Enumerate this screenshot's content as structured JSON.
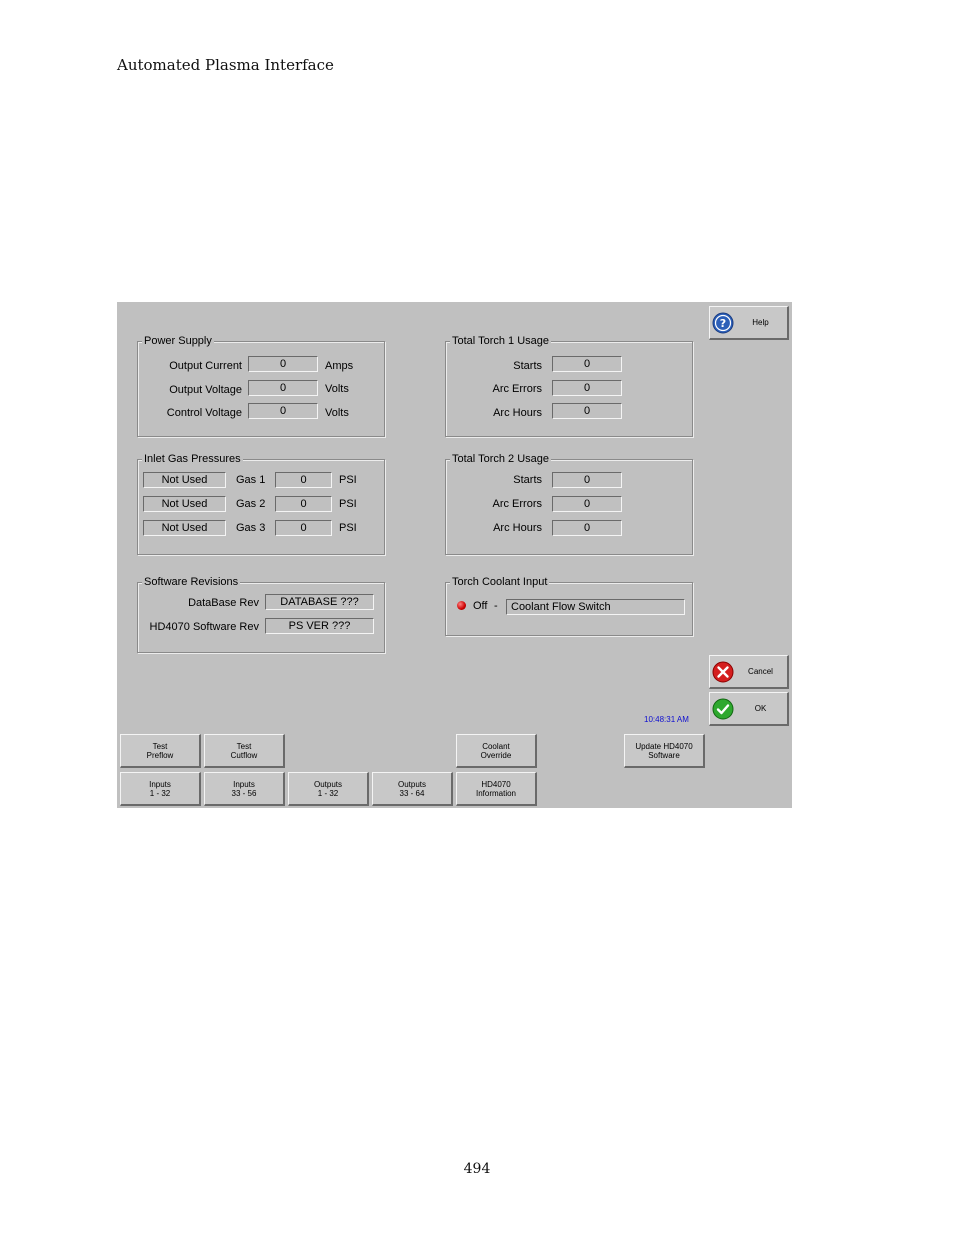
{
  "document": {
    "header": "Automated Plasma Interface",
    "page_number": "494"
  },
  "screen": {
    "help_label": "Help",
    "cancel_label": "Cancel",
    "ok_label": "OK",
    "clock": "10:48:31 AM",
    "power_supply": {
      "title": "Power Supply",
      "rows": [
        {
          "label": "Output Current",
          "value": "0",
          "unit": "Amps"
        },
        {
          "label": "Output Voltage",
          "value": "0",
          "unit": "Volts"
        },
        {
          "label": "Control Voltage",
          "value": "0",
          "unit": "Volts"
        }
      ]
    },
    "torch1": {
      "title": "Total Torch 1 Usage",
      "rows": [
        {
          "label": "Starts",
          "value": "0"
        },
        {
          "label": "Arc Errors",
          "value": "0"
        },
        {
          "label": "Arc Hours",
          "value": "0"
        }
      ]
    },
    "inlet_gas": {
      "title": "Inlet Gas Pressures",
      "rows": [
        {
          "status": "Not Used",
          "label": "Gas 1",
          "value": "0",
          "unit": "PSI"
        },
        {
          "status": "Not Used",
          "label": "Gas 2",
          "value": "0",
          "unit": "PSI"
        },
        {
          "status": "Not Used",
          "label": "Gas 3",
          "value": "0",
          "unit": "PSI"
        }
      ]
    },
    "torch2": {
      "title": "Total Torch 2 Usage",
      "rows": [
        {
          "label": "Starts",
          "value": "0"
        },
        {
          "label": "Arc Errors",
          "value": "0"
        },
        {
          "label": "Arc Hours",
          "value": "0"
        }
      ]
    },
    "software": {
      "title": "Software Revisions",
      "rows": [
        {
          "label": "DataBase Rev",
          "value": "DATABASE ???"
        },
        {
          "label": "HD4070 Software Rev",
          "value": "PS VER ???"
        }
      ]
    },
    "coolant": {
      "title": "Torch Coolant Input",
      "state": "Off",
      "dash": "-",
      "value": "Coolant Flow Switch",
      "led_color": "#cc0000"
    },
    "bottom_row1": [
      {
        "line1": "Test",
        "line2": "Preflow"
      },
      {
        "line1": "Test",
        "line2": "Cutflow"
      },
      {
        "line1": "Coolant",
        "line2": "Override"
      },
      {
        "line1": "Update HD4070",
        "line2": "Software"
      }
    ],
    "bottom_row2": [
      {
        "line1": "Inputs",
        "line2": "1 - 32"
      },
      {
        "line1": "Inputs",
        "line2": "33 - 56"
      },
      {
        "line1": "Outputs",
        "line2": "1 - 32"
      },
      {
        "line1": "Outputs",
        "line2": "33 - 64"
      },
      {
        "line1": "HD4070",
        "line2": "Information"
      }
    ],
    "icons": {
      "help": "help-question-icon",
      "cancel": "cancel-x-icon",
      "ok": "ok-check-icon",
      "led": "led-indicator-icon"
    }
  }
}
